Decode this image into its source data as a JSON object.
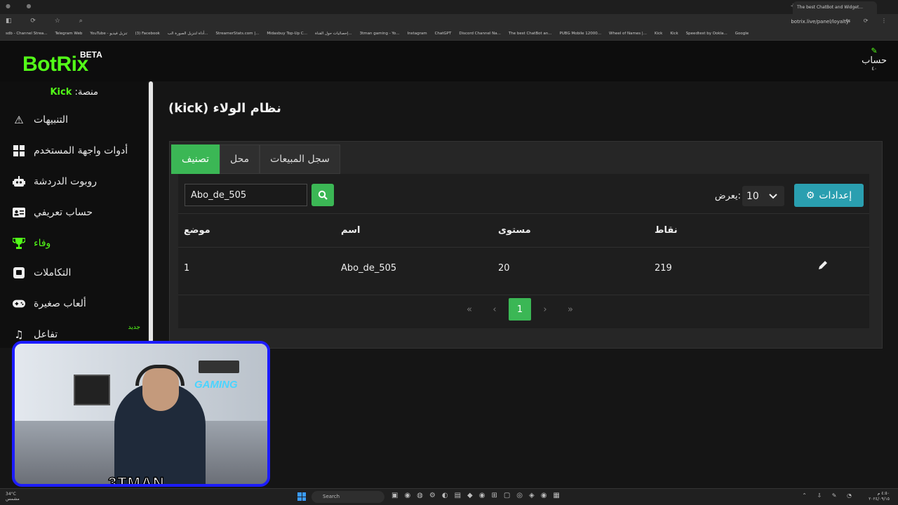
{
  "browser": {
    "tab_title": "The best ChatBot and Widget...",
    "url": "botrix.live/panel/loyalty",
    "bookmarks": [
      "sdb - Channel Strea...",
      "Telegram Web",
      "YouTube - تنزيل فيديو",
      "(3) Facebook",
      "أداة لتنزيل الصورة الب...",
      "StreamerStats.com |...",
      "Midasbuy Top-Up C...",
      "إحصائيات حول القناة...",
      "3tman gaming - Yo...",
      "Instagram",
      "ChatGPT",
      "Discord Channel Na...",
      "The best ChatBot an...",
      "PUBG Mobile 12000...",
      "Wheel of Names |...",
      "Kick",
      "Kick",
      "Speedtest by Ookla...",
      "Google"
    ]
  },
  "header": {
    "logo": "BotRix",
    "beta": "BETA",
    "account_label": "حساب",
    "account_sub": "٤٠"
  },
  "sidebar": {
    "platform_prefix": "منصة:",
    "platform_name": "Kick",
    "new_badge": "جديد",
    "items": [
      {
        "label": "التنبيهات",
        "icon": "warning-icon"
      },
      {
        "label": "أدوات واجهة المستخدم",
        "icon": "grid-icon"
      },
      {
        "label": "روبوت الدردشة",
        "icon": "robot-icon"
      },
      {
        "label": "حساب تعريفي",
        "icon": "id-card-icon"
      },
      {
        "label": "وفاء",
        "icon": "trophy-icon"
      },
      {
        "label": "التكاملات",
        "icon": "integration-icon"
      },
      {
        "label": "ألعاب صغيرة",
        "icon": "gamepad-icon"
      },
      {
        "label": "تفاعل",
        "icon": "music-icon"
      }
    ]
  },
  "main": {
    "title": "نظام الولاء (kick)",
    "tabs": [
      "تصنيف",
      "محل",
      "سجل المبيعات"
    ],
    "search_value": "Abo_de_505",
    "settings_label": "إعدادات",
    "show_label": "يعرض:",
    "show_value": "10",
    "table": {
      "headers": [
        "موضع",
        "اسم",
        "مستوى",
        "نقاط"
      ],
      "rows": [
        {
          "position": "1",
          "name": "Abo_de_505",
          "level": "20",
          "points": "219"
        }
      ]
    },
    "pagination": {
      "current": "1"
    }
  },
  "webcam": {
    "sign": "GAMING",
    "streamer": "3TMAN"
  },
  "taskbar": {
    "weather": "34°C",
    "weather_sub": "مشمس",
    "search_placeholder": "Search",
    "time": "٤:٥٠ م",
    "date": "٢٠٢٤/٠٩/١٥"
  },
  "colors": {
    "brand": "#53fc18",
    "accent_green": "#3bb755",
    "settings_teal": "#2a9fb0"
  }
}
